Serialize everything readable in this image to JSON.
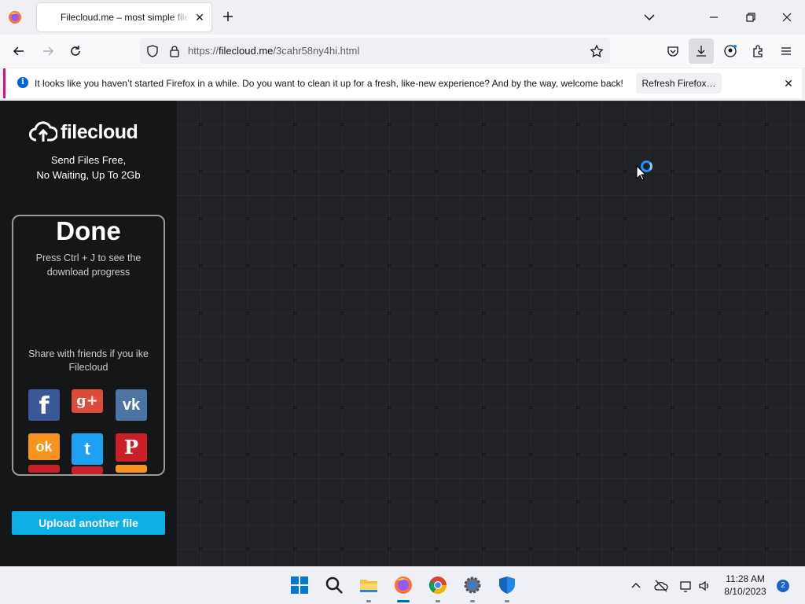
{
  "browser": {
    "tab_title": "Filecloud.me – most simple file",
    "url_prefix": "https://",
    "url_domain": "filecloud.me",
    "url_path": "/3cahr58ny4hi.html",
    "notification": {
      "message": "It looks like you haven’t started Firefox in a while. Do you want to clean it up for a fresh, like-new experience? And by the way, welcome back!",
      "button": "Refresh Firefox…"
    }
  },
  "sidebar": {
    "logo": "filecloud",
    "tagline_1": "Send Files Free,",
    "tagline_2": "No Waiting, Up To 2Gb",
    "done_title": "Done",
    "done_sub_1": "Press Ctrl + J to see the",
    "done_sub_2": "download progress",
    "share_1": "Share with friends if you ike",
    "share_2": "Filecloud",
    "social": [
      {
        "name": "facebook",
        "glyph": "f",
        "color": "#3b5998"
      },
      {
        "name": "google-plus",
        "glyph": "g+",
        "color": "#dd4b39"
      },
      {
        "name": "vk",
        "glyph": "vk",
        "color": "#4c75a3"
      },
      {
        "name": "odnoklassniki",
        "glyph": "ok",
        "color": "#f7931e"
      },
      {
        "name": "twitter",
        "glyph": "t",
        "color": "#1da1f2"
      },
      {
        "name": "pinterest",
        "glyph": "P",
        "color": "#cb2027"
      }
    ],
    "upload_button": "Upload another file"
  },
  "taskbar": {
    "time": "11:28 AM",
    "date": "8/10/2023",
    "notification_count": "2"
  },
  "colors": {
    "accent": "#0eaee6",
    "page_bg": "#202225",
    "sidebar_bg": "#151617",
    "notification_bar": "#d90c7a"
  }
}
